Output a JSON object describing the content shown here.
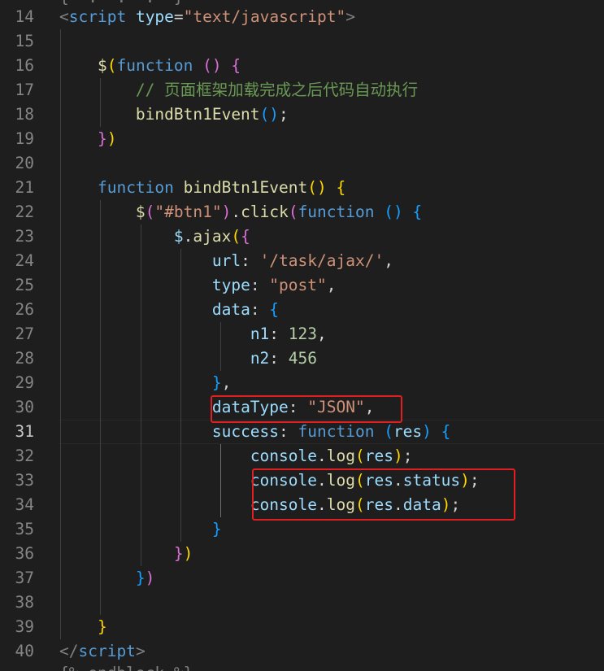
{
  "editor": {
    "partial_top": "{  .  .  .  }",
    "partial_bottom": "{% endblock %}",
    "line_numbers": [
      "14",
      "15",
      "16",
      "17",
      "18",
      "19",
      "20",
      "21",
      "22",
      "23",
      "24",
      "25",
      "26",
      "27",
      "28",
      "29",
      "30",
      "31",
      "32",
      "33",
      "34",
      "35",
      "36",
      "37",
      "38",
      "39",
      "40"
    ],
    "active_line": "31",
    "lines": [
      [
        {
          "t": "<",
          "c": "k-tag"
        },
        {
          "t": "script",
          "c": "k-tagname"
        },
        {
          "t": " ",
          "c": "k-p"
        },
        {
          "t": "type",
          "c": "k-attr"
        },
        {
          "t": "=",
          "c": "k-p"
        },
        {
          "t": "\"text/javascript\"",
          "c": "k-str"
        },
        {
          "t": ">",
          "c": "k-tag"
        }
      ],
      [],
      [
        {
          "t": "    ",
          "c": "k-p"
        },
        {
          "t": "$",
          "c": "k-fn"
        },
        {
          "t": "(",
          "c": "b1"
        },
        {
          "t": "function",
          "c": "k-kw"
        },
        {
          "t": " ",
          "c": "k-p"
        },
        {
          "t": "()",
          "c": "b2"
        },
        {
          "t": " ",
          "c": "k-p"
        },
        {
          "t": "{",
          "c": "b2"
        }
      ],
      [
        {
          "t": "        ",
          "c": "k-p"
        },
        {
          "t": "// 页面框架加载完成之后代码自动执行",
          "c": "k-cm"
        }
      ],
      [
        {
          "t": "        ",
          "c": "k-p"
        },
        {
          "t": "bindBtn1Event",
          "c": "k-fn"
        },
        {
          "t": "()",
          "c": "b3"
        },
        {
          "t": ";",
          "c": "k-p"
        }
      ],
      [
        {
          "t": "    ",
          "c": "k-p"
        },
        {
          "t": "}",
          "c": "b2"
        },
        {
          "t": ")",
          "c": "b1"
        }
      ],
      [],
      [
        {
          "t": "    ",
          "c": "k-p"
        },
        {
          "t": "function",
          "c": "k-kw"
        },
        {
          "t": " ",
          "c": "k-p"
        },
        {
          "t": "bindBtn1Event",
          "c": "k-fn"
        },
        {
          "t": "()",
          "c": "b1"
        },
        {
          "t": " ",
          "c": "k-p"
        },
        {
          "t": "{",
          "c": "b1"
        }
      ],
      [
        {
          "t": "        ",
          "c": "k-p"
        },
        {
          "t": "$",
          "c": "k-fn"
        },
        {
          "t": "(",
          "c": "b2"
        },
        {
          "t": "\"#btn1\"",
          "c": "k-str"
        },
        {
          "t": ")",
          "c": "b2"
        },
        {
          "t": ".",
          "c": "k-p"
        },
        {
          "t": "click",
          "c": "k-fn"
        },
        {
          "t": "(",
          "c": "b2"
        },
        {
          "t": "function",
          "c": "k-kw"
        },
        {
          "t": " ",
          "c": "k-p"
        },
        {
          "t": "()",
          "c": "b3"
        },
        {
          "t": " ",
          "c": "k-p"
        },
        {
          "t": "{",
          "c": "b3"
        }
      ],
      [
        {
          "t": "            ",
          "c": "k-p"
        },
        {
          "t": "$",
          "c": "k-var"
        },
        {
          "t": ".",
          "c": "k-p"
        },
        {
          "t": "ajax",
          "c": "k-fn"
        },
        {
          "t": "(",
          "c": "b1"
        },
        {
          "t": "{",
          "c": "b2"
        }
      ],
      [
        {
          "t": "                ",
          "c": "k-p"
        },
        {
          "t": "url",
          "c": "k-var"
        },
        {
          "t": ": ",
          "c": "k-p"
        },
        {
          "t": "'/task/ajax/'",
          "c": "k-str"
        },
        {
          "t": ",",
          "c": "k-p"
        }
      ],
      [
        {
          "t": "                ",
          "c": "k-p"
        },
        {
          "t": "type",
          "c": "k-var"
        },
        {
          "t": ": ",
          "c": "k-p"
        },
        {
          "t": "\"post\"",
          "c": "k-str"
        },
        {
          "t": ",",
          "c": "k-p"
        }
      ],
      [
        {
          "t": "                ",
          "c": "k-p"
        },
        {
          "t": "data",
          "c": "k-var"
        },
        {
          "t": ": ",
          "c": "k-p"
        },
        {
          "t": "{",
          "c": "b3"
        }
      ],
      [
        {
          "t": "                    ",
          "c": "k-p"
        },
        {
          "t": "n1",
          "c": "k-var"
        },
        {
          "t": ": ",
          "c": "k-p"
        },
        {
          "t": "123",
          "c": "k-num"
        },
        {
          "t": ",",
          "c": "k-p"
        }
      ],
      [
        {
          "t": "                    ",
          "c": "k-p"
        },
        {
          "t": "n2",
          "c": "k-var"
        },
        {
          "t": ": ",
          "c": "k-p"
        },
        {
          "t": "456",
          "c": "k-num"
        }
      ],
      [
        {
          "t": "                ",
          "c": "k-p"
        },
        {
          "t": "}",
          "c": "b3"
        },
        {
          "t": ",",
          "c": "k-p"
        }
      ],
      [
        {
          "t": "                ",
          "c": "k-p"
        },
        {
          "t": "dataType",
          "c": "k-var"
        },
        {
          "t": ": ",
          "c": "k-p"
        },
        {
          "t": "\"JSON\"",
          "c": "k-str"
        },
        {
          "t": ",",
          "c": "k-p"
        }
      ],
      [
        {
          "t": "                ",
          "c": "k-p"
        },
        {
          "t": "success",
          "c": "k-var"
        },
        {
          "t": ": ",
          "c": "k-p"
        },
        {
          "t": "function",
          "c": "k-kw"
        },
        {
          "t": " ",
          "c": "k-p"
        },
        {
          "t": "(",
          "c": "b3"
        },
        {
          "t": "res",
          "c": "k-var"
        },
        {
          "t": ")",
          "c": "b3"
        },
        {
          "t": " ",
          "c": "k-p"
        },
        {
          "t": "{",
          "c": "b3"
        }
      ],
      [
        {
          "t": "                    ",
          "c": "k-p"
        },
        {
          "t": "console",
          "c": "k-var"
        },
        {
          "t": ".",
          "c": "k-p"
        },
        {
          "t": "log",
          "c": "k-fn"
        },
        {
          "t": "(",
          "c": "b1"
        },
        {
          "t": "res",
          "c": "k-var"
        },
        {
          "t": ")",
          "c": "b1"
        },
        {
          "t": ";",
          "c": "k-p"
        }
      ],
      [
        {
          "t": "                    ",
          "c": "k-p"
        },
        {
          "t": "console",
          "c": "k-var"
        },
        {
          "t": ".",
          "c": "k-p"
        },
        {
          "t": "log",
          "c": "k-fn"
        },
        {
          "t": "(",
          "c": "b1"
        },
        {
          "t": "res",
          "c": "k-var"
        },
        {
          "t": ".",
          "c": "k-p"
        },
        {
          "t": "status",
          "c": "k-var"
        },
        {
          "t": ")",
          "c": "b1"
        },
        {
          "t": ";",
          "c": "k-p"
        }
      ],
      [
        {
          "t": "                    ",
          "c": "k-p"
        },
        {
          "t": "console",
          "c": "k-var"
        },
        {
          "t": ".",
          "c": "k-p"
        },
        {
          "t": "log",
          "c": "k-fn"
        },
        {
          "t": "(",
          "c": "b1"
        },
        {
          "t": "res",
          "c": "k-var"
        },
        {
          "t": ".",
          "c": "k-p"
        },
        {
          "t": "data",
          "c": "k-var"
        },
        {
          "t": ")",
          "c": "b1"
        },
        {
          "t": ";",
          "c": "k-p"
        }
      ],
      [
        {
          "t": "                ",
          "c": "k-p"
        },
        {
          "t": "}",
          "c": "b3"
        }
      ],
      [
        {
          "t": "            ",
          "c": "k-p"
        },
        {
          "t": "}",
          "c": "b2"
        },
        {
          "t": ")",
          "c": "b1"
        }
      ],
      [
        {
          "t": "        ",
          "c": "k-p"
        },
        {
          "t": "}",
          "c": "b3"
        },
        {
          "t": ")",
          "c": "b2"
        }
      ],
      [],
      [
        {
          "t": "    ",
          "c": "k-p"
        },
        {
          "t": "}",
          "c": "b1"
        }
      ],
      [
        {
          "t": "</",
          "c": "k-tag"
        },
        {
          "t": "script",
          "c": "k-tagname"
        },
        {
          "t": ">",
          "c": "k-tag"
        }
      ]
    ]
  }
}
